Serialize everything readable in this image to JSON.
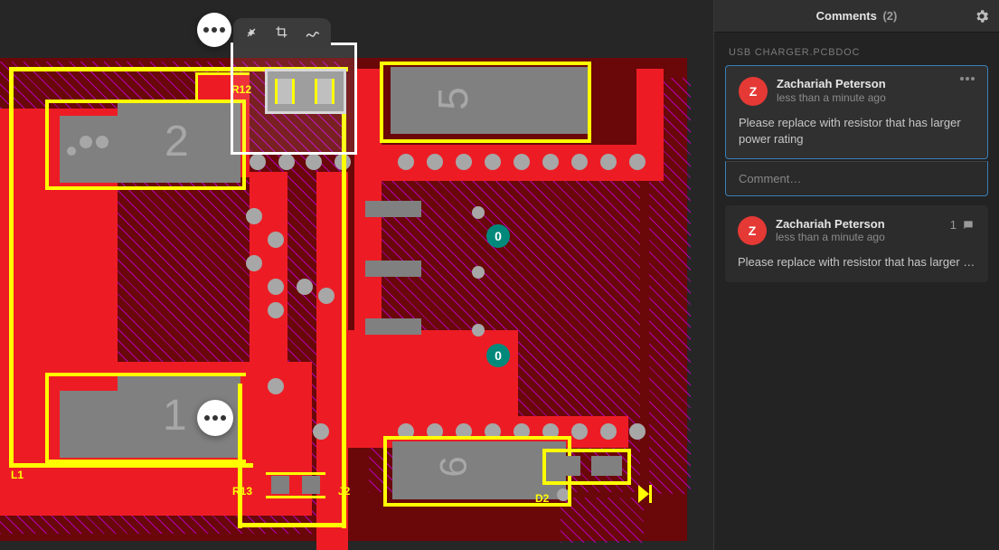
{
  "sidebar": {
    "title": "Comments",
    "count": "(2)",
    "document_label": "USB CHARGER.PCBDOC",
    "comments": [
      {
        "avatar_initial": "Z",
        "author": "Zachariah Peterson",
        "timestamp": "less than a minute ago",
        "body": "Please replace with resistor that has larger power rating",
        "selected": true,
        "reply_count": null
      },
      {
        "avatar_initial": "Z",
        "author": "Zachariah Peterson",
        "timestamp": "less than a minute ago",
        "body": "Please replace with resistor that has larger …",
        "selected": false,
        "reply_count": "1"
      }
    ],
    "comment_placeholder": "Comment…"
  },
  "pcb": {
    "designators": {
      "r12": "R12",
      "r13": "R13",
      "j2": "J2",
      "l1": "L1",
      "d2": "D2",
      "ref2": "2",
      "ref1": "1",
      "ref5": "5",
      "ref6": "6",
      "via0a": "0",
      "via0b": "0"
    }
  }
}
